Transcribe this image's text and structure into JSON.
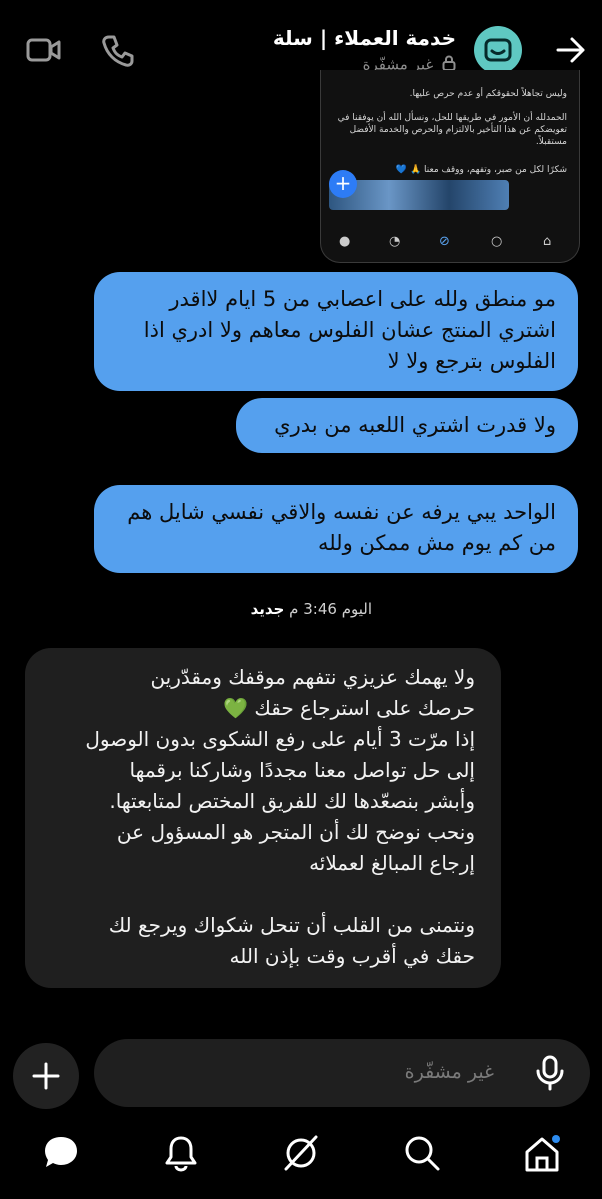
{
  "header": {
    "title": "خدمة العملاء | سلة",
    "subtitle": "غير مشفّرة",
    "icons": [
      "video-icon",
      "phone-icon",
      "avatar",
      "forward-arrow-icon"
    ]
  },
  "embedded_screenshot": {
    "line1": "وليس تجاهلاً لحقوقكم أو عدم حرص عليها.",
    "para2": "الحمدلله أن الأمور في طريقها للحل، ونسأل الله أن يوفقنا في تعويضكم عن هذا التأخير بالالتزام والحرص والخدمة الأفضل مستقبلاً.",
    "para3": "شكرًا لكل من صبر، وتفهم، ووقف معنا 🙏 💙"
  },
  "messages": [
    {
      "direction": "out",
      "text": "مو منطق ولله على اعصابي من 5 ايام لااقدر اشتري المنتج عشان الفلوس معاهم ولا ادري اذا الفلوس بترجع ولا لا"
    },
    {
      "direction": "out",
      "text": "ولا قدرت اشتري اللعبه من بدري"
    },
    {
      "direction": "out",
      "text": "الواحد يبي يرفه عن نفسه والاقي نفسي شايل هم من كم يوم مش ممكن ولله"
    }
  ],
  "timestamp": {
    "day": "اليوم",
    "time": "3:46 م",
    "new_label": "جديد"
  },
  "reply": {
    "direction": "in",
    "text": "ولا يهمك عزيزي نتفهم موقفك ومقدّرين\nحرصك على استرجاع حقك 💚\nإذا مرّت 3 أيام على رفع الشكوى بدون الوصول\nإلى حل تواصل معنا مجددًا وشاركنا برقمها\nوأبشر بنصعّدها لك للفريق المختص لمتابعتها.\nونحب نوضح لك أن المتجر هو المسؤول عن\nإرجاع المبالغ لعملائه\n\nونتمنى من القلب أن تنحل شكواك ويرجع لك\nحقك في أقرب وقت بإذن الله"
  },
  "composer": {
    "placeholder": "غير مشفّرة"
  },
  "bottom_nav": [
    "chat-icon",
    "bell-icon",
    "grok-icon",
    "search-icon",
    "home-icon"
  ]
}
